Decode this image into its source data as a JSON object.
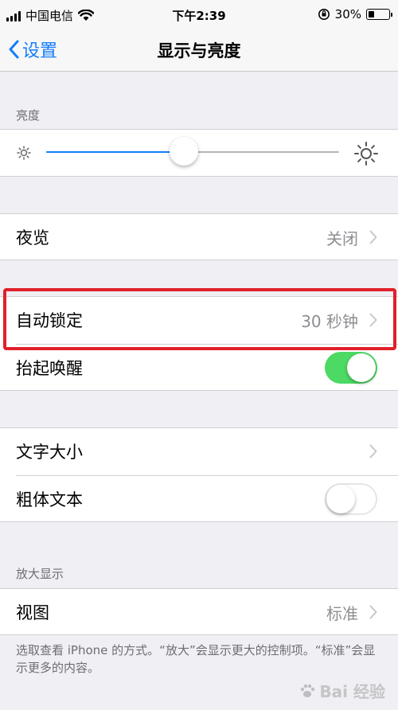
{
  "status_bar": {
    "carrier": "中国电信",
    "time": "下午2:39",
    "battery_percent": "30%",
    "battery_level": 0.3,
    "icons": [
      "signal-icon",
      "wifi-icon",
      "orientation-lock-icon",
      "battery-icon"
    ]
  },
  "nav": {
    "back_label": "设置",
    "title": "显示与亮度"
  },
  "brightness": {
    "header": "亮度",
    "level": 0.47
  },
  "night_shift": {
    "label": "夜览",
    "value": "关闭"
  },
  "auto_lock": {
    "label": "自动锁定",
    "value": "30 秒钟"
  },
  "raise_to_wake": {
    "label": "抬起唤醒",
    "enabled": true
  },
  "text_size": {
    "label": "文字大小"
  },
  "bold_text": {
    "label": "粗体文本",
    "enabled": false
  },
  "zoom": {
    "header": "放大显示",
    "view_label": "视图",
    "view_value": "标准",
    "footer": "选取查看 iPhone 的方式。“放大”会显示更大的控制项。“标准”会显示更多的内容。"
  },
  "watermark": "Bai 经验",
  "colors": {
    "accent": "#147efb",
    "toggle_on": "#4cd964",
    "highlight": "#e0202a"
  }
}
